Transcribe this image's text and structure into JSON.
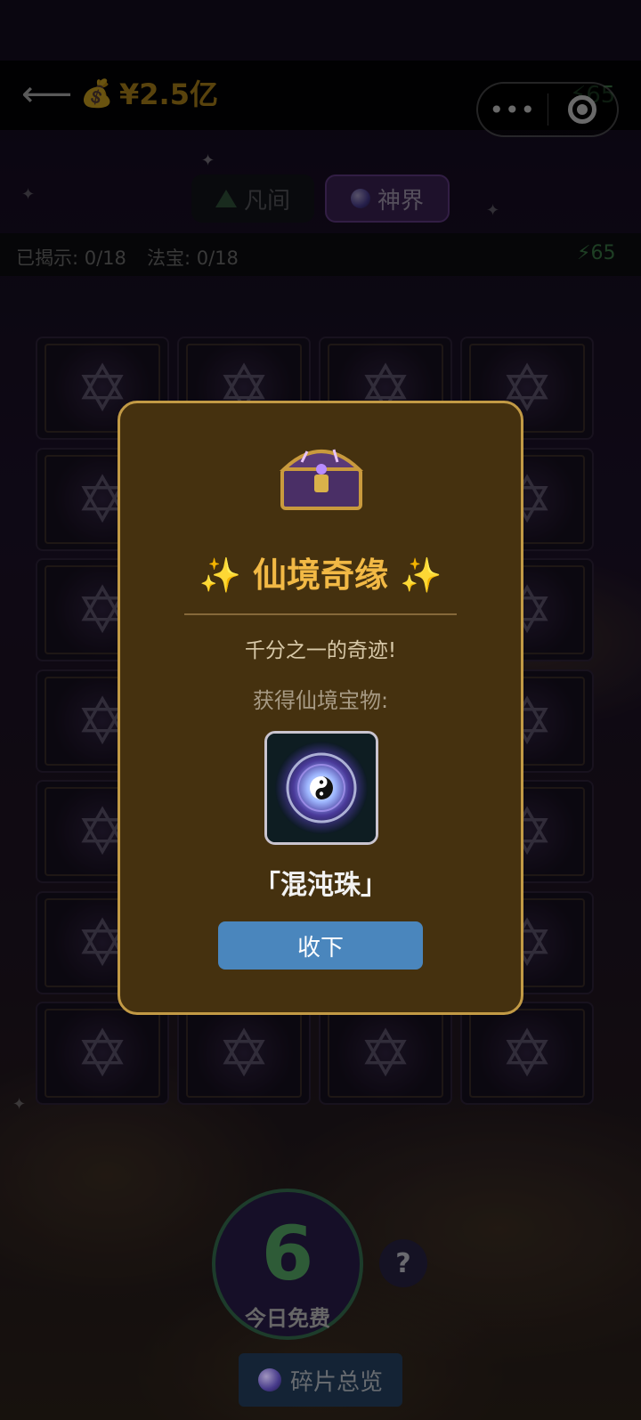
{
  "header": {
    "back_icon": "arrow-left-icon",
    "money_icon": "money-bag-icon",
    "money": "¥2.5亿",
    "energy": "65",
    "capsule_more": "•••"
  },
  "tabs": [
    {
      "label": "凡间",
      "icon": "pyramid-icon",
      "active": false
    },
    {
      "label": "神界",
      "icon": "orb-icon",
      "active": true
    }
  ],
  "stats": {
    "revealed": "已揭示: 0/18",
    "treasures": "法宝: 0/18",
    "energy": "65"
  },
  "grid": {
    "rows": 7,
    "cols": 4,
    "card_icon": "hexagram-icon"
  },
  "modal": {
    "icon": "treasure-chest-icon",
    "title": "✨ 仙境奇缘 ✨",
    "subtitle": "千分之一的奇迹!",
    "gain_label": "获得仙境宝物:",
    "item_icon": "chaos-orb-icon",
    "item_name": "「混沌珠」",
    "accept_label": "收下"
  },
  "bottom": {
    "free_count": "6",
    "free_label": "今日免费",
    "help_label": "?",
    "fragments_label": "碎片总览"
  },
  "colors": {
    "gold": "#f2b945",
    "money": "#d9a521",
    "energy": "#4a9a5a",
    "modal_bg": "#45310f",
    "button": "#4a86bd"
  }
}
